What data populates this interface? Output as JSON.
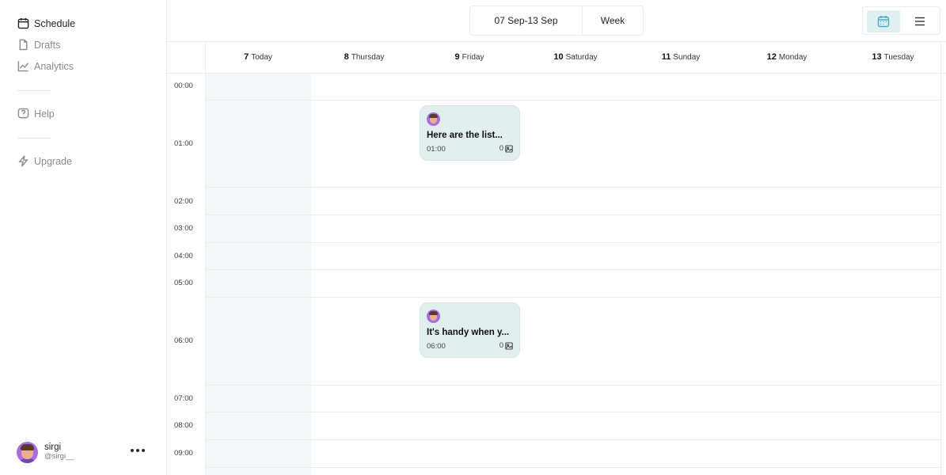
{
  "sidebar": {
    "items": [
      {
        "label": "Schedule",
        "icon": "calendar-icon",
        "active": true
      },
      {
        "label": "Drafts",
        "icon": "document-icon"
      },
      {
        "label": "Analytics",
        "icon": "line-chart-icon"
      },
      {
        "label": "Help",
        "icon": "help-icon"
      },
      {
        "label": "Upgrade",
        "icon": "lightning-icon"
      }
    ],
    "user": {
      "name": "sirgi",
      "handle": "@sirgi__"
    }
  },
  "topbar": {
    "date_range": "07 Sep-13 Sep",
    "view_mode": "Week"
  },
  "calendar": {
    "days": [
      {
        "num": "7",
        "name": "Today"
      },
      {
        "num": "8",
        "name": "Thursday"
      },
      {
        "num": "9",
        "name": "Friday"
      },
      {
        "num": "10",
        "name": "Saturday"
      },
      {
        "num": "11",
        "name": "Sunday"
      },
      {
        "num": "12",
        "name": "Monday"
      },
      {
        "num": "13",
        "name": "Tuesday"
      }
    ],
    "times": [
      "00:00",
      "01:00",
      "02:00",
      "03:00",
      "04:00",
      "05:00",
      "06:00",
      "07:00",
      "08:00",
      "09:00"
    ],
    "events": [
      {
        "title": "Here are the list...",
        "time": "01:00",
        "media_count": "0"
      },
      {
        "title": "It's handy when y...",
        "time": "06:00",
        "media_count": "0"
      }
    ]
  },
  "colors": {
    "accent": "#4aa9c7",
    "event_bg": "#e0eeed",
    "today_bg": "#f3f7f7"
  }
}
